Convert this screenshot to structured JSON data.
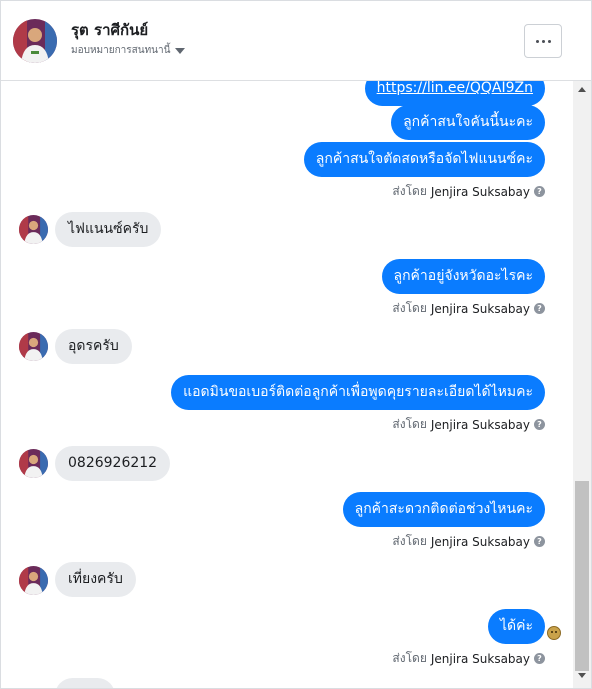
{
  "header": {
    "contact_name": "รุต ราศีกันย์",
    "assign_label": "มอบหมายการสนทนานี้"
  },
  "messages": {
    "m1": "https://lin.ee/QQAI9Zn",
    "m2": "ลูกค้าสนใจคันนี้นะคะ",
    "m3": "ลูกค้าสนใจตัดสดหรือจัดไฟแนนซ์คะ",
    "m4": "ไฟแนนซ์ครับ",
    "m5": "ลูกค้าอยู่จังหวัดอะไรคะ",
    "m6": "อุดรครับ",
    "m7": "แอดมินขอเบอร์ติดต่อลูกค้าเพื่อพูดคุยรายละเอียดได้ไหมคะ",
    "m8": "0826926212",
    "m9": "ลูกค้าสะดวกติดต่อช่วงไหนคะ",
    "m10": "เที่ยงครับ",
    "m11": "ได้ค่ะ"
  },
  "sent_by": {
    "prefix": "ส่งโดย",
    "agent": "Jenjira Suksabay"
  },
  "colors": {
    "outgoing_bubble": "#0a7cff",
    "incoming_bubble": "#e9ebee"
  },
  "icons": {
    "more": "more-dots-icon",
    "caret": "caret-down-icon",
    "info": "question-circle-icon"
  }
}
